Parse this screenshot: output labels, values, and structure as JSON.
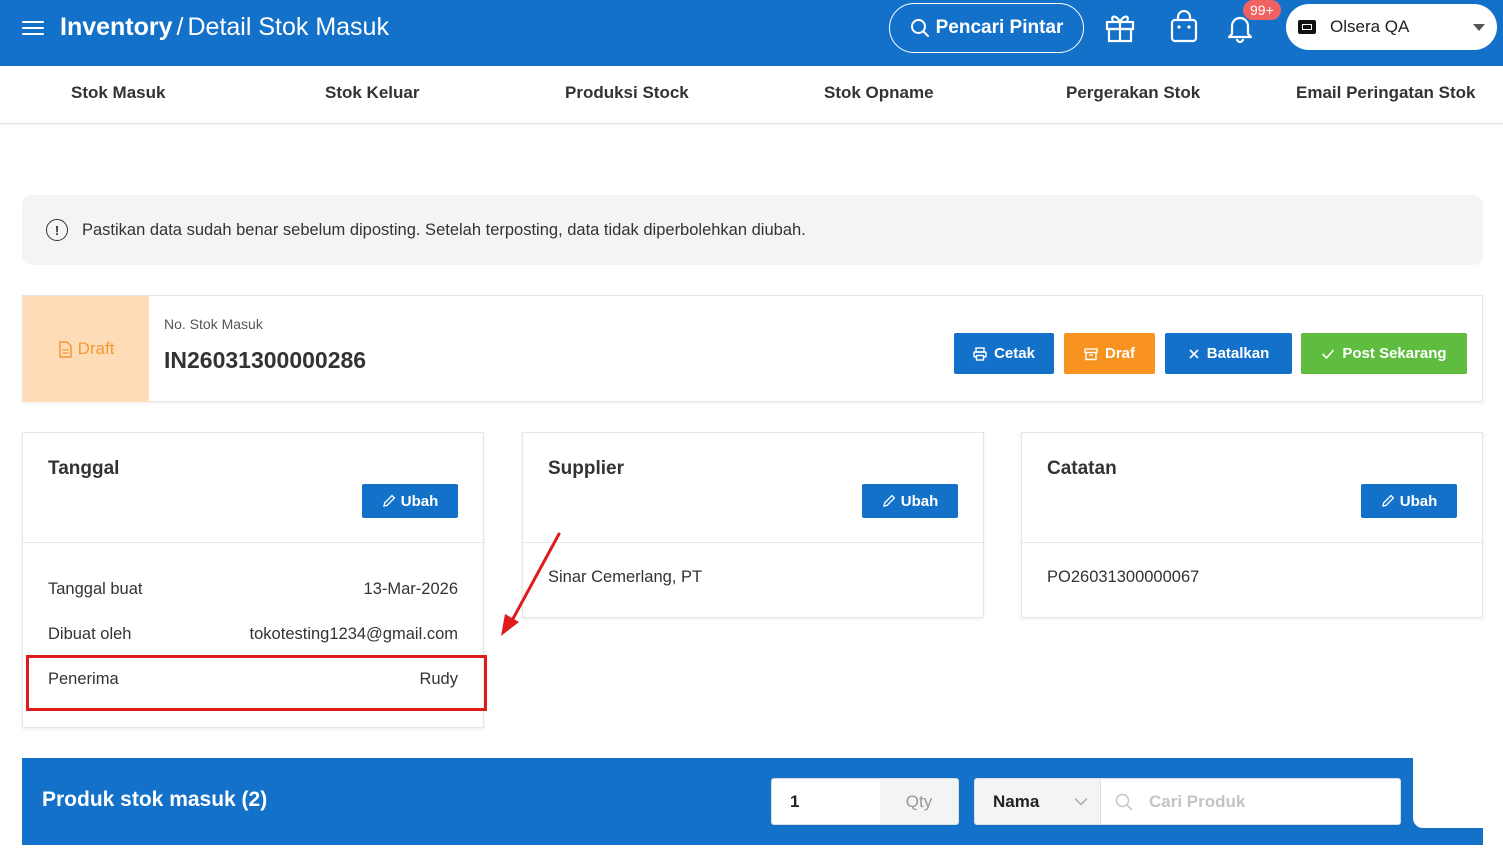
{
  "header": {
    "module": "Inventory",
    "separator": "/",
    "page": "Detail Stok Masuk",
    "smart_search_label": "Pencari Pintar",
    "notification_badge": "99+",
    "store_name": "Olsera QA"
  },
  "subnav": {
    "items": [
      {
        "label": "Stok Masuk"
      },
      {
        "label": "Stok Keluar"
      },
      {
        "label": "Produksi Stock"
      },
      {
        "label": "Stok Opname"
      },
      {
        "label": "Pergerakan Stok"
      },
      {
        "label": "Email Peringatan Stok"
      }
    ]
  },
  "alert": {
    "text": "Pastikan data sudah benar sebelum diposting. Setelah terposting, data tidak diperbolehkan diubah."
  },
  "document": {
    "status": "Draft",
    "number_label": "No. Stok Masuk",
    "number": "IN26031300000286",
    "actions": {
      "print": "Cetak",
      "draft": "Draf",
      "cancel": "Batalkan",
      "post": "Post Sekarang"
    }
  },
  "cards": {
    "tanggal": {
      "title": "Tanggal",
      "edit_label": "Ubah",
      "rows": [
        {
          "label": "Tanggal buat",
          "value": "13-Mar-2026"
        },
        {
          "label": "Dibuat oleh",
          "value": "tokotesting1234@gmail.com"
        },
        {
          "label": "Penerima",
          "value": "Rudy"
        }
      ]
    },
    "supplier": {
      "title": "Supplier",
      "edit_label": "Ubah",
      "value": "Sinar Cemerlang, PT"
    },
    "catatan": {
      "title": "Catatan",
      "edit_label": "Ubah",
      "value": "PO26031300000067"
    }
  },
  "products": {
    "title": "Produk stok masuk (2)",
    "qty_value": "1",
    "qty_suffix": "Qty",
    "search_by": "Nama",
    "search_placeholder": "Cari Produk"
  },
  "colors": {
    "primary": "#1471c9",
    "draft_bg": "#fddcb7",
    "draft_text": "#f39a35",
    "orange": "#f7931e",
    "green": "#5ebd3e",
    "annotation_red": "#e01b1b"
  }
}
